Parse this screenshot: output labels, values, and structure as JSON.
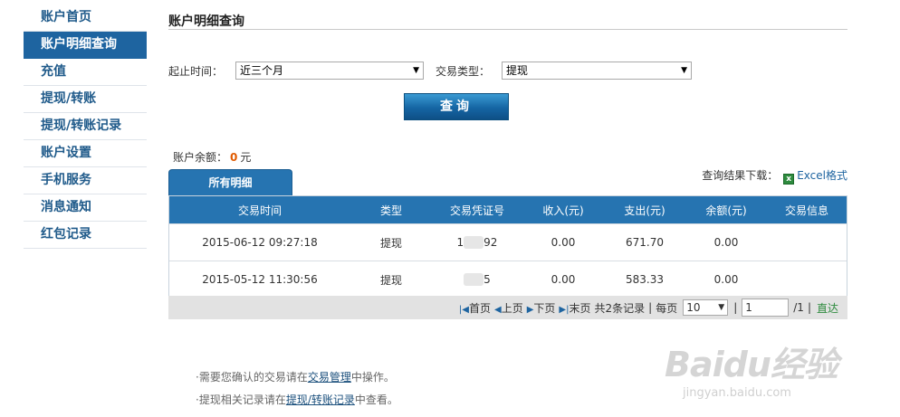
{
  "sidebar": {
    "items": [
      {
        "label": "账户首页",
        "active": false
      },
      {
        "label": "账户明细查询",
        "active": true
      },
      {
        "label": "充值",
        "active": false
      },
      {
        "label": "提现/转账",
        "active": false
      },
      {
        "label": "提现/转账记录",
        "active": false
      },
      {
        "label": "账户设置",
        "active": false
      },
      {
        "label": "手机服务",
        "active": false
      },
      {
        "label": "消息通知",
        "active": false
      },
      {
        "label": "红包记录",
        "active": false
      }
    ]
  },
  "page": {
    "title": "账户明细查询"
  },
  "filters": {
    "time_label": "起止时间：",
    "time_value": "近三个月",
    "type_label": "交易类型：",
    "type_value": "提现",
    "query_button": "查询"
  },
  "balance": {
    "label": "账户余额：",
    "amount": "0",
    "unit": "元"
  },
  "download": {
    "label": "查询结果下载：",
    "link": "Excel格式"
  },
  "tab": {
    "label": "所有明细"
  },
  "table": {
    "headers": [
      "交易时间",
      "类型",
      "交易凭证号",
      "收入(元)",
      "支出(元)",
      "余额(元)",
      "交易信息"
    ],
    "rows": [
      {
        "time": "2015-06-12 09:27:18",
        "type": "提现",
        "voucher_start": "1",
        "voucher_end": "92",
        "income": "0.00",
        "expense": "671.70",
        "balance": "0.00",
        "info": ""
      },
      {
        "time": "2015-05-12 11:30:56",
        "type": "提现",
        "voucher_start": "",
        "voucher_end": "5",
        "income": "0.00",
        "expense": "583.33",
        "balance": "0.00",
        "info": ""
      }
    ]
  },
  "pager": {
    "first": "首页",
    "prev": "上页",
    "next": "下页",
    "last": "末页",
    "total": "共2条记录",
    "per_page_label": "每页",
    "per_page": "10",
    "page_input": "1",
    "page_total": "/1",
    "go": "直达"
  },
  "notes": {
    "line1_pre": "·需要您确认的交易请在",
    "line1_link": "交易管理",
    "line1_post": "中操作。",
    "line2_pre": "·提现相关记录请在",
    "line2_link": "提现/转账记录",
    "line2_post": "中查看。"
  },
  "watermark": {
    "main": "Baidu经验",
    "sub": "jingyan.baidu.com"
  },
  "colors": {
    "accent": "#1e64a0",
    "header_blue": "#2674b1",
    "balance_amount": "#e05a00",
    "excel_green": "#2e8b3e"
  }
}
